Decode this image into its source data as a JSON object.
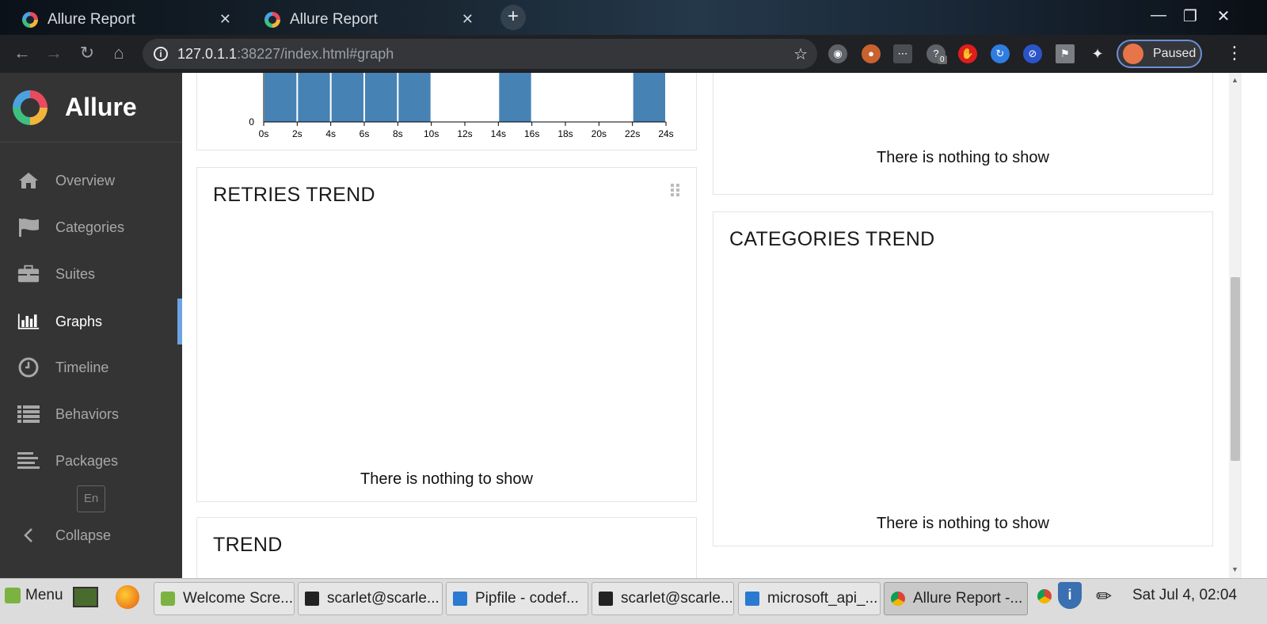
{
  "browser": {
    "tabs": [
      {
        "title": "Allure Report",
        "close": "✕"
      },
      {
        "title": "Allure Report",
        "close": "✕"
      }
    ],
    "new_tab": "+",
    "window_controls": {
      "minimize": "—",
      "maximize": "❐",
      "close": "✕"
    },
    "url_host": "127.0.1.1",
    "url_rest": ":38227/index.html#graph",
    "extension_badge": "0",
    "profile_label": "Paused"
  },
  "sidebar": {
    "brand": "Allure",
    "items": [
      {
        "label": "Overview",
        "icon": "home-icon"
      },
      {
        "label": "Categories",
        "icon": "flag-icon"
      },
      {
        "label": "Suites",
        "icon": "briefcase-icon"
      },
      {
        "label": "Graphs",
        "icon": "bar-chart-icon",
        "active": true
      },
      {
        "label": "Timeline",
        "icon": "clock-icon"
      },
      {
        "label": "Behaviors",
        "icon": "list-icon"
      },
      {
        "label": "Packages",
        "icon": "align-left-icon"
      }
    ],
    "language": "En",
    "collapse": "Collapse",
    "active_color": "#6da3e0"
  },
  "cards": {
    "duration": {
      "chart_data": {
        "type": "bar",
        "x_ticks": [
          "0s",
          "2s",
          "4s",
          "6s",
          "8s",
          "10s",
          "12s",
          "14s",
          "16s",
          "18s",
          "20s",
          "22s",
          "24s"
        ],
        "y_ticks": [
          "0"
        ],
        "bins": [
          {
            "from": 0,
            "to": 2,
            "filled": true
          },
          {
            "from": 2,
            "to": 4,
            "filled": true
          },
          {
            "from": 4,
            "to": 6,
            "filled": true
          },
          {
            "from": 6,
            "to": 8,
            "filled": true
          },
          {
            "from": 8,
            "to": 10,
            "filled": true
          },
          {
            "from": 14,
            "to": 16,
            "filled": true
          },
          {
            "from": 22,
            "to": 24,
            "filled": true
          }
        ],
        "xlim": [
          0,
          24
        ],
        "bar_color": "#4682b4"
      }
    },
    "top_right": {
      "empty": "There is nothing to show"
    },
    "retries_trend": {
      "title": "RETRIES TREND",
      "empty": "There is nothing to show"
    },
    "categories_trend": {
      "title": "CATEGORIES TREND",
      "empty": "There is nothing to show"
    },
    "trend": {
      "title": "TREND"
    }
  },
  "taskbar": {
    "menu": "Menu",
    "tasks": [
      "Welcome Scre...",
      "scarlet@scarle...",
      "Pipfile - codef...",
      "scarlet@scarle...",
      "microsoft_api_...",
      "Allure Report -..."
    ],
    "clock": "Sat Jul  4, 02:04"
  }
}
